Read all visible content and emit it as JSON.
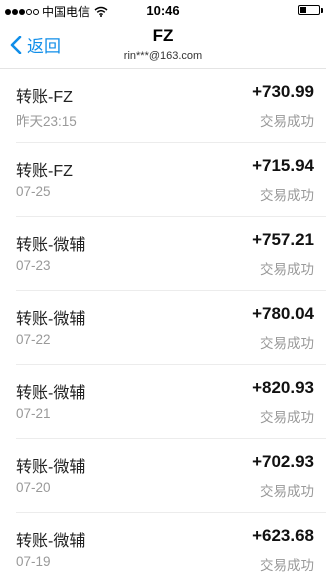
{
  "status_bar": {
    "carrier": "中国电信",
    "time": "10:46",
    "signal_bars_filled": 3,
    "signal_bars_total": 5
  },
  "nav": {
    "back_label": "返回",
    "title": "FZ",
    "subtitle": "rin***@163.com",
    "accent_color": "#108ee9"
  },
  "transactions": [
    {
      "title": "转账-FZ",
      "date": "昨天23:15",
      "amount": "+730.99",
      "status": "交易成功"
    },
    {
      "title": "转账-FZ",
      "date": "07-25",
      "amount": "+715.94",
      "status": "交易成功"
    },
    {
      "title": "转账-微辅",
      "date": "07-23",
      "amount": "+757.21",
      "status": "交易成功"
    },
    {
      "title": "转账-微辅",
      "date": "07-22",
      "amount": "+780.04",
      "status": "交易成功"
    },
    {
      "title": "转账-微辅",
      "date": "07-21",
      "amount": "+820.93",
      "status": "交易成功"
    },
    {
      "title": "转账-微辅",
      "date": "07-20",
      "amount": "+702.93",
      "status": "交易成功"
    },
    {
      "title": "转账-微辅",
      "date": "07-19",
      "amount": "+623.68",
      "status": "交易成功"
    }
  ]
}
